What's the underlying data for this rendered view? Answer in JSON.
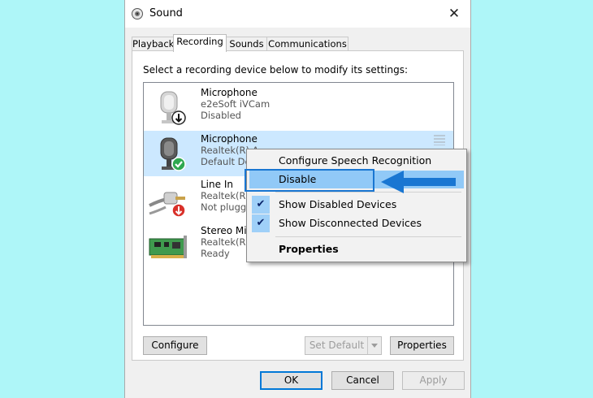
{
  "window": {
    "title": "Sound",
    "close": "✕"
  },
  "tabs": [
    {
      "label": "Playback",
      "active": false
    },
    {
      "label": "Recording",
      "active": true
    },
    {
      "label": "Sounds",
      "active": false
    },
    {
      "label": "Communications",
      "active": false
    }
  ],
  "instruction": "Select a recording device below to modify its settings:",
  "devices": [
    {
      "name": "Microphone",
      "line2": "e2eSoft iVCam",
      "line3": "Disabled",
      "icon": "microphone-icon",
      "badge": "down-arrow-badge-icon",
      "selected": false
    },
    {
      "name": "Microphone",
      "line2": "Realtek(R) A",
      "line3": "Default De",
      "icon": "microphone-icon",
      "badge": "green-check-badge-icon",
      "selected": true
    },
    {
      "name": "Line In",
      "line2": "Realtek(R) A",
      "line3": "Not plugge",
      "icon": "line-in-cable-icon",
      "badge": "red-down-arrow-badge-icon",
      "selected": false
    },
    {
      "name": "Stereo Mix",
      "line2": "Realtek(R) A",
      "line3": "Ready",
      "icon": "sound-card-icon",
      "badge": null,
      "selected": false
    }
  ],
  "context_menu": {
    "items": [
      {
        "label": "Configure Speech Recognition",
        "checked": false,
        "hover": false,
        "bold": false
      },
      {
        "label": "Disable",
        "checked": false,
        "hover": true,
        "bold": false
      },
      {
        "label": "Show Disabled Devices",
        "checked": true,
        "hover": false,
        "bold": false
      },
      {
        "label": "Show Disconnected Devices",
        "checked": true,
        "hover": false,
        "bold": false
      },
      {
        "label": "Properties",
        "checked": false,
        "hover": false,
        "bold": true
      }
    ],
    "check_glyph": "✔"
  },
  "panel_buttons": {
    "configure": "Configure",
    "set_default": "Set Default",
    "properties": "Properties"
  },
  "dialog_buttons": {
    "ok": "OK",
    "cancel": "Cancel",
    "apply": "Apply"
  },
  "colors": {
    "background": "#aef6f8",
    "selection": "#cce8ff",
    "menu_hover": "#91c9f7",
    "annotation_blue": "#1976d2"
  }
}
